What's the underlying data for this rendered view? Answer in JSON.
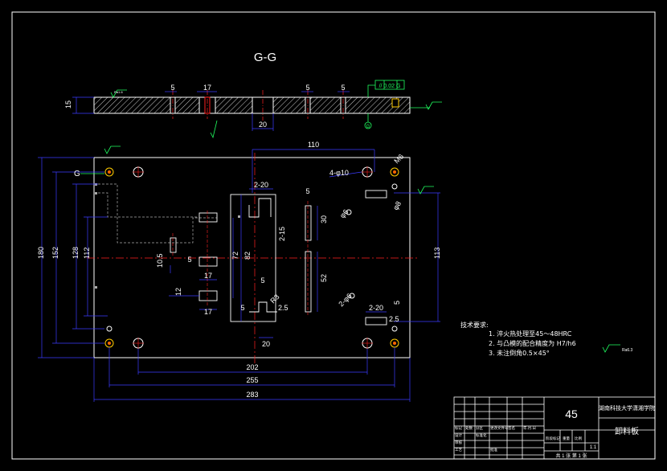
{
  "view_title": "G-G",
  "colors": {
    "background": "#000000",
    "outline": "#ffffff",
    "dimension": "#3c3cff",
    "centerline": "#ff2020",
    "hatch": "#ffffff",
    "hidden": "#ff2020",
    "symbol": "#20ff60",
    "hole_outline": "#ffcc00"
  },
  "section_view": {
    "thickness_label": "15",
    "dims": [
      "5",
      "17",
      "5",
      "5",
      "20"
    ],
    "tolerance_frame": "// 0.02 G",
    "datum": "G"
  },
  "plan_view": {
    "datum_label": "G",
    "overall_dims": {
      "height": "180",
      "height_2": "152",
      "height_3": "128",
      "height_4": "112",
      "top_span": "110",
      "right_span": "113",
      "bottom_spans": [
        "202",
        "255",
        "283"
      ]
    },
    "hole_notes": {
      "four_holes": "4-φ10",
      "corner_holes": "M6",
      "pin": "φ8",
      "hole_a": "φ6",
      "hole_b": "2-φ6"
    },
    "slot_dims": {
      "slot_top": "2-20",
      "slot_bottom": "2-20",
      "slot_side": "2-15",
      "slot_w": "5",
      "len_a": "30",
      "len_b": "52",
      "len_c": "82",
      "len_d": "72",
      "len_e": "20",
      "len_f": "5",
      "r": "R3",
      "chamfer": "2.5",
      "left_a": "10.5",
      "left_b": "5",
      "left_c": "17",
      "left_d": "12",
      "left_e": "17",
      "right_w": "5",
      "right_x": "2.5"
    }
  },
  "notes": {
    "heading": "技术要求:",
    "items": [
      "1.  淬火热处理至45～48HRC",
      "2.  与凸模的配合精度为 H7/h6",
      "3.  未注倒角0.5×45°"
    ]
  },
  "title_block": {
    "material": "45",
    "school": "湖南科技大学潇湘学院",
    "part_name": "卸料板",
    "scale": "1:1",
    "sheet": "共 1 张  第 1 张",
    "cells": [
      "标记",
      "处数",
      "分区",
      "更改文件号",
      "签名",
      "年.月.日",
      "设计",
      "标准化",
      "阶段标记",
      "重量",
      "比例",
      "审核",
      "工艺",
      "批准"
    ]
  },
  "roughness": {
    "general": "Ra6.3",
    "top": "Ra1.6"
  }
}
